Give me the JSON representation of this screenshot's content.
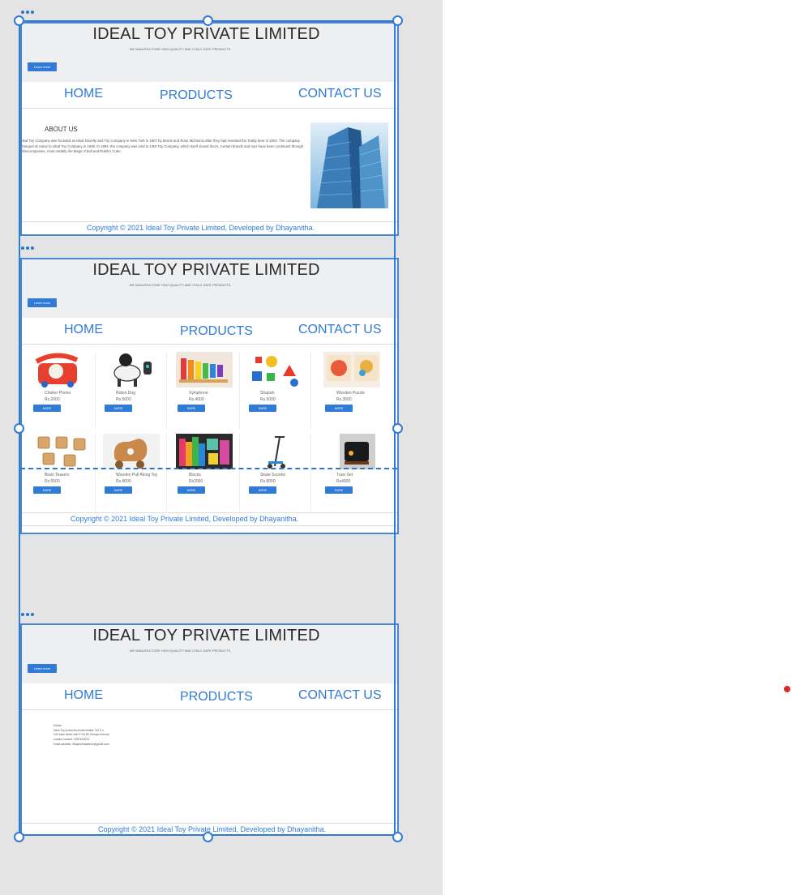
{
  "company": {
    "title": "IDEAL TOY PRIVATE LIMITED",
    "tagline": "WE MANUFACTURE HIGH QUALITY AND CHILD SAFE PRODUCTS",
    "learn_more": "Learn more"
  },
  "nav": {
    "home": "HOME",
    "products": "PRODUCTS",
    "contact": "CONTACT US"
  },
  "footer": "Copyright © 2021 Ideal Toy Private Limited, Developed by Dhayanitha.",
  "about": {
    "heading": "ABOUT US",
    "text": "Ideal Toy Company was founded as Ideal Novelty and Toy Company in New York in 1907 by Morris and Rose Michtoms after they had invented the Teddy bear in 1903. The company changed its name to Ideal Toy Company in 1938. In 1982, the company was sold to CBS Toy Company, which itself closed doors. Certain brands and toys have been continued through othercompanies, most notably the Magic 8 ball and Rubik's Cube."
  },
  "products": {
    "more_label": "MORE",
    "items": [
      {
        "name": "Chatter Phone",
        "price": "Rs.2000"
      },
      {
        "name": "Robot Dog",
        "price": "Rs.5000"
      },
      {
        "name": "Xylophone",
        "price": "Rs.4000"
      },
      {
        "name": "Shapick",
        "price": "Rs.5000"
      },
      {
        "name": "Wooden Puzzle",
        "price": "Rs.3500"
      },
      {
        "name": "Brain Teasers",
        "price": "Rs.5500"
      },
      {
        "name": "Wooden Pull Along Toy",
        "price": "Rs.8000"
      },
      {
        "name": "Blocks",
        "price": "Rs2000"
      },
      {
        "name": "Skate Scooter",
        "price": "Rs.8000"
      },
      {
        "name": "Train Set",
        "price": "Rs4000"
      }
    ]
  },
  "contact": {
    "lines": [
      "Enlace",
      "Ideal Toy products private limited, NO 5 n",
      "132 main street salt IT Rd Rk Giriraja chennai",
      "contact number: 9087615023",
      "email address: dhayanithasatson@gmail.com"
    ]
  },
  "colors": {
    "accent": "#2f7bd6",
    "selection": "#2f74c9",
    "canvas": "#e4e4e4"
  }
}
